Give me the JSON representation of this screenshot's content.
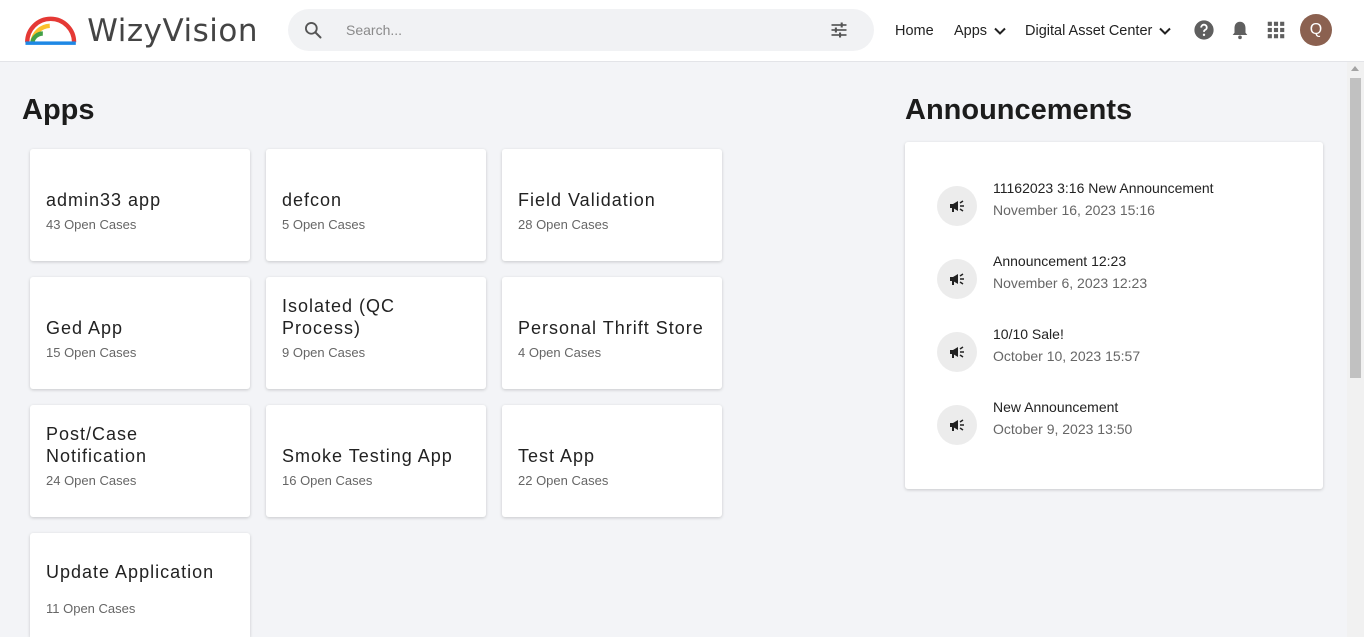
{
  "brand": {
    "name": "WizyVision"
  },
  "search": {
    "placeholder": "Search..."
  },
  "nav": {
    "home": "Home",
    "apps": "Apps",
    "digital_asset_center": "Digital Asset Center"
  },
  "user": {
    "initial": "Q"
  },
  "apps": {
    "title": "Apps",
    "items": [
      {
        "name": "admin33 app",
        "count": "43 Open Cases"
      },
      {
        "name": "defcon",
        "count": "5 Open Cases"
      },
      {
        "name": "Field Validation",
        "count": "28 Open Cases"
      },
      {
        "name": "Ged App",
        "count": "15 Open Cases"
      },
      {
        "name": "Isolated (QC Process)",
        "count": "9 Open Cases"
      },
      {
        "name": "Personal Thrift Store",
        "count": "4 Open Cases"
      },
      {
        "name": "Post/Case Notification",
        "count": "24 Open Cases"
      },
      {
        "name": "Smoke Testing App",
        "count": "16 Open Cases"
      },
      {
        "name": "Test App",
        "count": "22 Open Cases"
      },
      {
        "name": "Update Application",
        "count": "11 Open Cases"
      }
    ]
  },
  "announcements": {
    "title": "Announcements",
    "items": [
      {
        "title": "11162023 3:16 New Announcement",
        "date": "November 16, 2023 15:16"
      },
      {
        "title": "Announcement 12:23",
        "date": "November 6, 2023 12:23"
      },
      {
        "title": "10/10 Sale!",
        "date": "October 10, 2023 15:57"
      },
      {
        "title": "New Announcement",
        "date": "October 9, 2023 13:50"
      }
    ]
  },
  "icons": {
    "search": "search-icon",
    "filter": "sliders-icon",
    "chevron": "chevron-down-icon",
    "help": "help-icon",
    "notifications": "bell-icon",
    "apps_grid": "grid-icon",
    "announcement": "megaphone-icon"
  },
  "colors": {
    "avatar": "#8b6150",
    "background": "#f3f4f7"
  }
}
